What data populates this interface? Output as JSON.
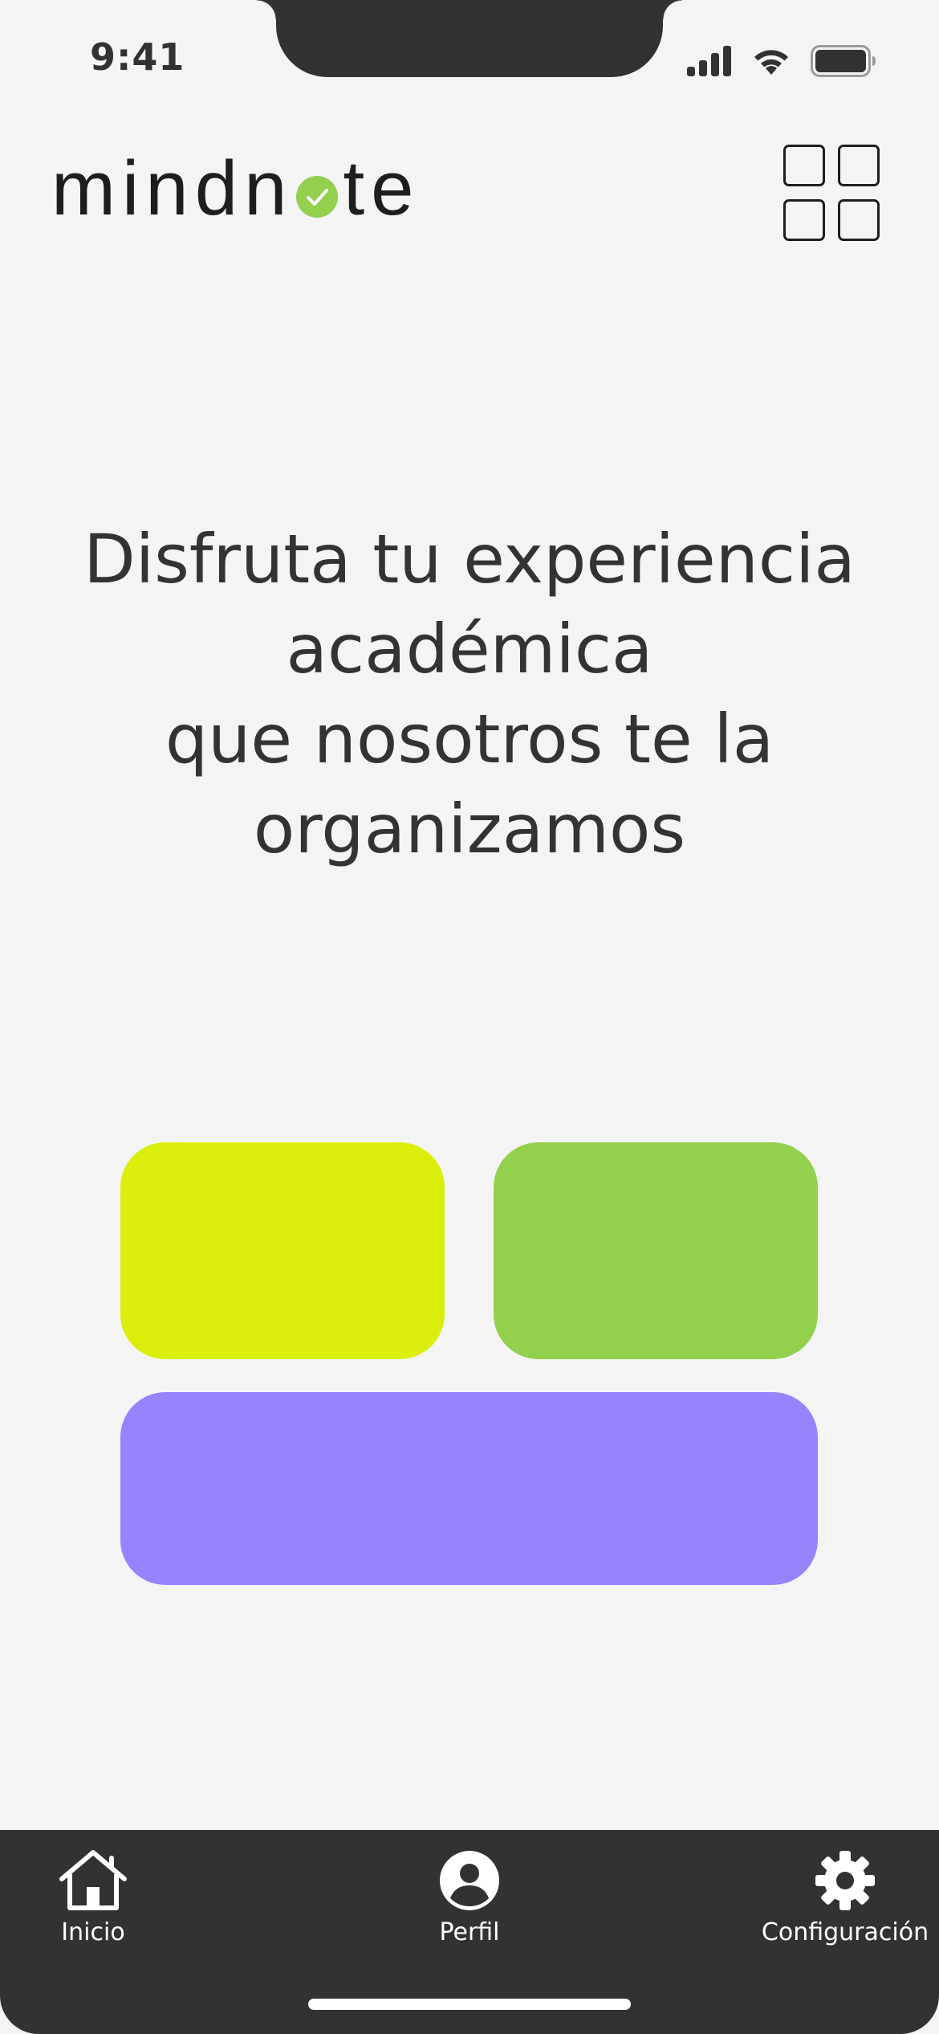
{
  "status_bar": {
    "time": "9:41",
    "icons": [
      "cellular-signal-icon",
      "wifi-icon",
      "battery-icon"
    ]
  },
  "header": {
    "logo_prefix": "mindn",
    "logo_suffix": "te",
    "menu_icon": "grid-menu-icon"
  },
  "hero": {
    "lines": [
      "Disfruta tu experiencia",
      "académica",
      "que nosotros te la",
      "organizamos"
    ]
  },
  "cards": {
    "colors": [
      "#dcee0b",
      "#92d04e",
      "#9683fd"
    ]
  },
  "bottom_nav": {
    "items": [
      {
        "label": "Inicio",
        "icon": "home-icon"
      },
      {
        "label": "Perfil",
        "icon": "profile-icon"
      },
      {
        "label": "Configuración",
        "icon": "gear-icon"
      }
    ]
  },
  "colors": {
    "background": "#f4f4f4",
    "dark": "#323232",
    "accent_green": "#92d04e",
    "accent_yellow": "#dcee0b",
    "accent_purple": "#9683fd"
  }
}
